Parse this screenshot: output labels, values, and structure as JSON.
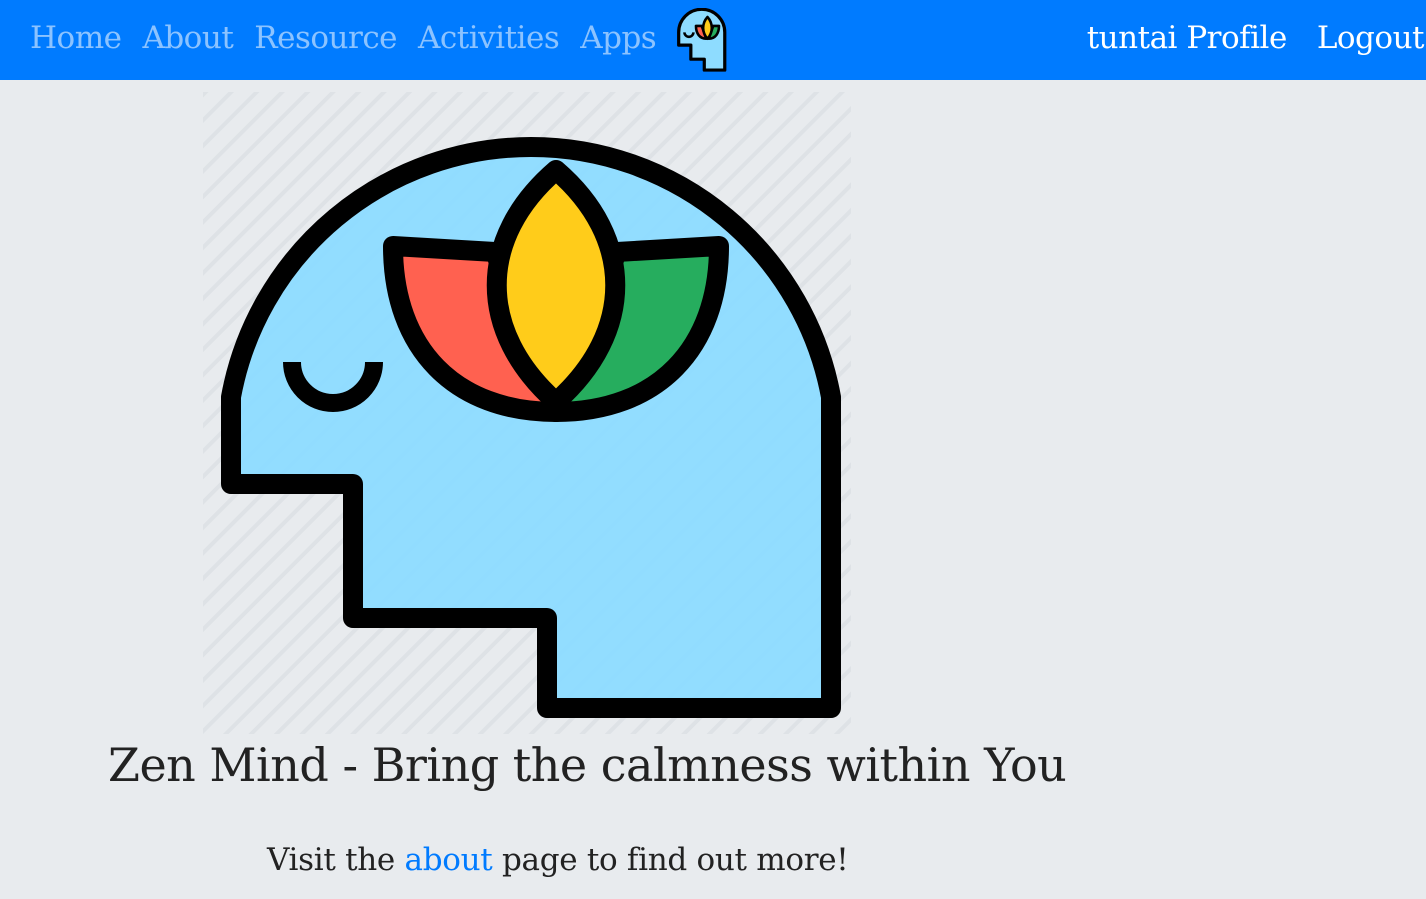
{
  "nav": {
    "links": [
      "Home",
      "About",
      "Resource",
      "Activities",
      "Apps"
    ],
    "logo_icon": "zen-head-icon",
    "profile_label": "tuntai Profile",
    "logout_label": "Logout"
  },
  "hero": {
    "image_icon": "zen-head-lotus-icon",
    "title": "Zen Mind - Bring the calmness within You",
    "text_before": "Visit the ",
    "link_text": "about",
    "text_after": " page to find out more!"
  },
  "colors": {
    "navbar": "#007bff",
    "background": "#e8ebee",
    "head_fill": "#8edcff",
    "petal_red": "#ff6150",
    "petal_yellow": "#ffcc1a",
    "petal_green": "#26ad5e",
    "link": "#007bff"
  }
}
